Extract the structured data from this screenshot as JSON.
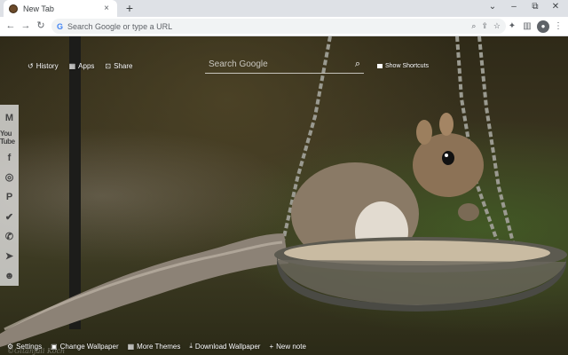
{
  "browser": {
    "tab_title": "New Tab",
    "tab_close": "×",
    "new_tab": "+",
    "minimize": "–",
    "restore": "⧉",
    "close": "✕",
    "tab_list": "⌄",
    "omnibox_placeholder": "Search Google or type a URL",
    "back": "←",
    "forward": "→",
    "reload": "↻",
    "zoom": "⌕",
    "share": "⇪",
    "bookmark": "☆",
    "extensions": "✦",
    "sidepanel": "▥",
    "profile": "●",
    "menu": "⋮"
  },
  "newtab": {
    "links": [
      {
        "icon": "history-icon",
        "glyph": "↺",
        "label": "History"
      },
      {
        "icon": "apps-icon",
        "glyph": "▦",
        "label": "Apps"
      },
      {
        "icon": "share-icon",
        "glyph": "⊡",
        "label": "Share"
      }
    ],
    "search_placeholder": "Search Google",
    "search_glyph": "⌕",
    "show_shortcuts": "Show Shortcuts",
    "social": [
      {
        "name": "gmail-icon",
        "glyph": "M"
      },
      {
        "name": "youtube-icon",
        "glyph": "You Tube"
      },
      {
        "name": "facebook-icon",
        "glyph": "f"
      },
      {
        "name": "instagram-icon",
        "glyph": "◎"
      },
      {
        "name": "pinterest-icon",
        "glyph": "P"
      },
      {
        "name": "twitter-icon",
        "glyph": "✔"
      },
      {
        "name": "whatsapp-icon",
        "glyph": "✆"
      },
      {
        "name": "telegram-icon",
        "glyph": "➤"
      },
      {
        "name": "reddit-icon",
        "glyph": "☻"
      }
    ],
    "bottom": [
      {
        "icon": "settings-icon",
        "glyph": "⚙",
        "label": "Settings"
      },
      {
        "icon": "image-icon",
        "glyph": "▣",
        "label": "Change Wallpaper"
      },
      {
        "icon": "grid-icon",
        "glyph": "▦",
        "label": "More Themes"
      },
      {
        "icon": "download-icon",
        "glyph": "⤓",
        "label": "Download Wallpaper"
      },
      {
        "icon": "plus-icon",
        "glyph": "+",
        "label": "New note"
      }
    ],
    "watermark": "©Gitanjali Koch"
  },
  "colors": {
    "accent": "#4285f4",
    "tabstrip": "#dee1e6",
    "omnibox": "#f1f3f4"
  }
}
